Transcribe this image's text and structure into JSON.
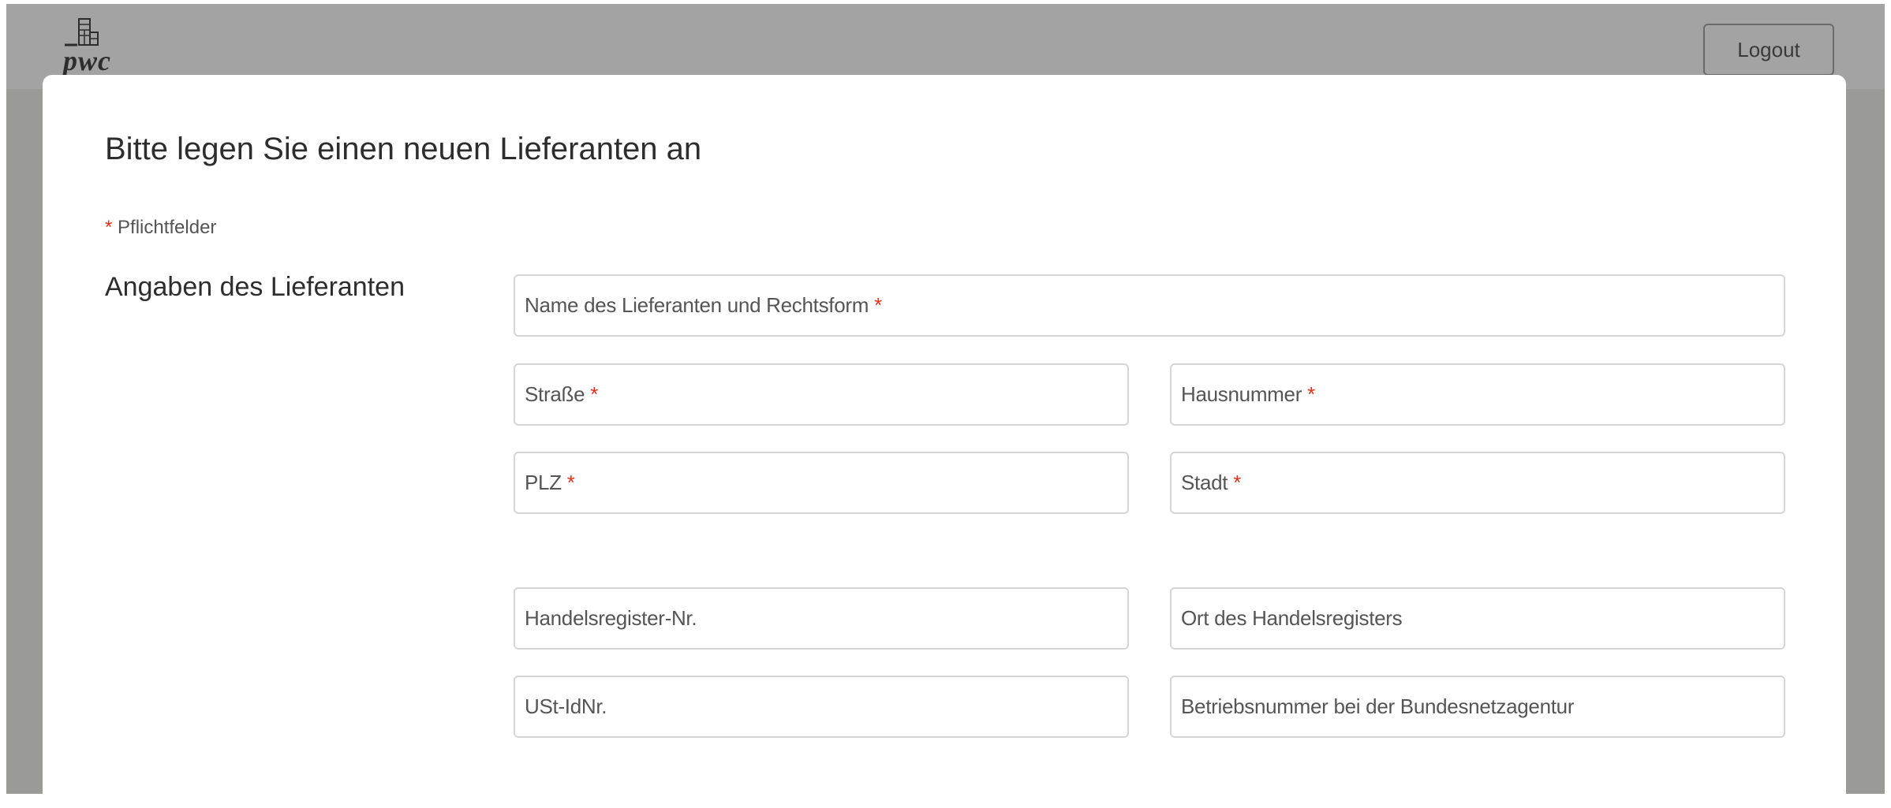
{
  "header": {
    "logo_text": "pwc",
    "logout_label": "Logout"
  },
  "form": {
    "title": "Bitte legen Sie einen neuen Lieferanten an",
    "required_marker": "*",
    "required_note": "Pflichtfelder",
    "section_label": "Angaben des Lieferanten",
    "fields": {
      "name": {
        "placeholder": "Name des Lieferanten und Rechtsform",
        "required": true,
        "value": ""
      },
      "street": {
        "placeholder": "Straße",
        "required": true,
        "value": ""
      },
      "house_number": {
        "placeholder": "Hausnummer",
        "required": true,
        "value": ""
      },
      "postal_code": {
        "placeholder": "PLZ",
        "required": true,
        "value": ""
      },
      "city": {
        "placeholder": "Stadt",
        "required": true,
        "value": ""
      },
      "trade_register_number": {
        "placeholder": "Handelsregister-Nr.",
        "required": false,
        "value": ""
      },
      "trade_register_location": {
        "placeholder": "Ort des Handelsregisters",
        "required": false,
        "value": ""
      },
      "vat_id": {
        "placeholder": "USt-IdNr.",
        "required": false,
        "value": ""
      },
      "network_agency_number": {
        "placeholder": "Betriebsnummer bei der Bundesnetzagentur",
        "required": false,
        "value": ""
      }
    }
  },
  "colors": {
    "backdrop": "#9a9a98",
    "header": "#a3a3a3",
    "required_star": "#e0301e",
    "field_border": "#d5d5d5"
  }
}
